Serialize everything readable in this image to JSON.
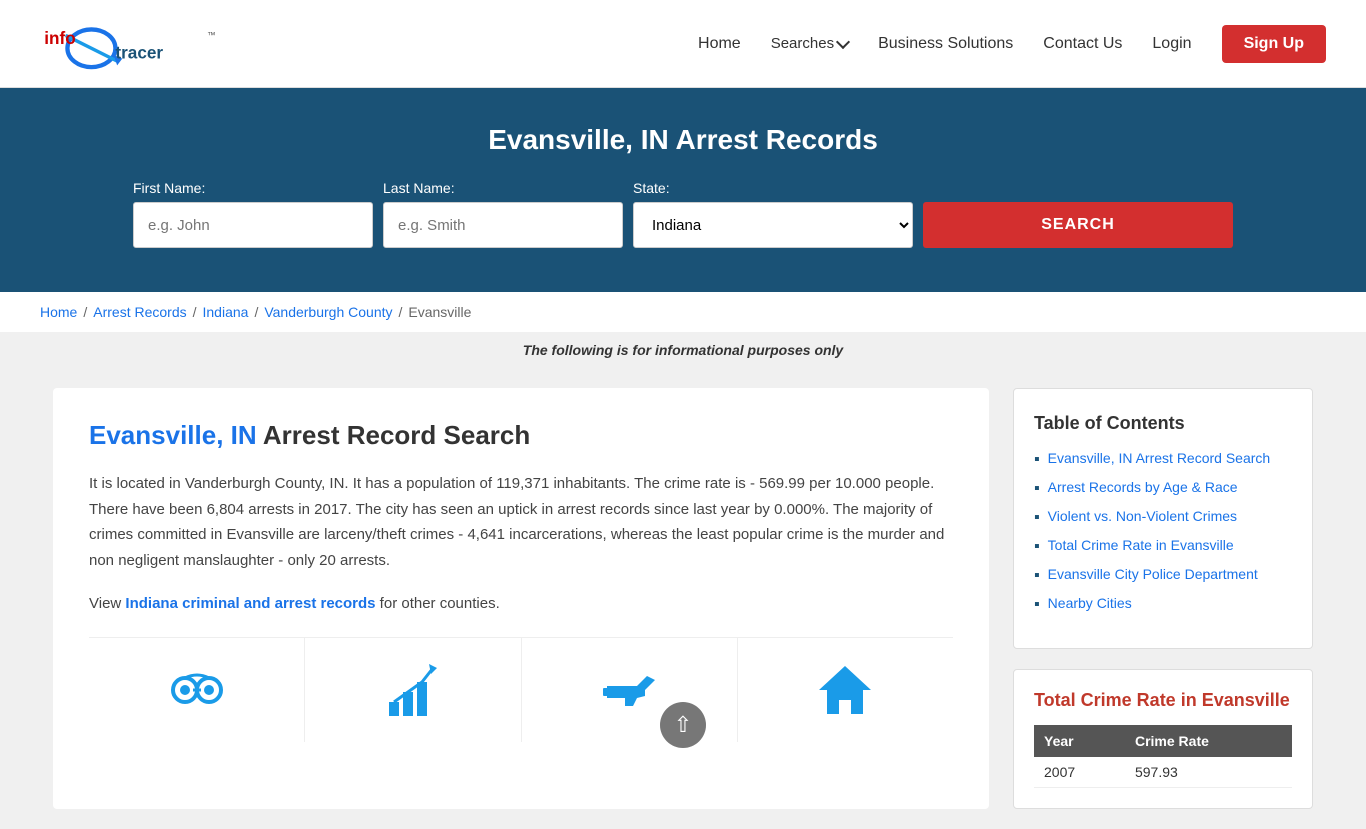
{
  "header": {
    "logo_alt": "InfoTracer",
    "nav": {
      "home": "Home",
      "searches": "Searches",
      "business_solutions": "Business Solutions",
      "contact_us": "Contact Us",
      "login": "Login",
      "signup": "Sign Up"
    }
  },
  "hero": {
    "title": "Evansville, IN Arrest Records",
    "form": {
      "first_name_label": "First Name:",
      "first_name_placeholder": "e.g. John",
      "last_name_label": "Last Name:",
      "last_name_placeholder": "e.g. Smith",
      "state_label": "State:",
      "state_value": "Indiana",
      "search_button": "SEARCH"
    }
  },
  "breadcrumb": {
    "home": "Home",
    "arrest_records": "Arrest Records",
    "indiana": "Indiana",
    "county": "Vanderburgh County",
    "city": "Evansville"
  },
  "disclaimer": "The following is for informational purposes only",
  "main": {
    "page_title_city": "Evansville,",
    "page_title_state": " IN ",
    "page_title_rest": "Arrest Record Search",
    "description": "It is located in Vanderburgh County, IN. It has a population of 119,371 inhabitants. The crime rate is - 569.99 per 10.000 people. There have been 6,804 arrests in 2017. The city has seen an uptick in arrest records since last year by 0.000%. The majority of crimes committed in Evansville are larceny/theft crimes - 4,641 incarcerations, whereas the least popular crime is the murder and non negligent manslaughter - only 20 arrests.",
    "view_prefix": "View ",
    "link_text": "Indiana criminal and arrest records",
    "view_suffix": " for other counties."
  },
  "toc": {
    "title": "Table of Contents",
    "items": [
      {
        "label": "Evansville, IN Arrest Record Search",
        "href": "#search"
      },
      {
        "label": "Arrest Records by Age & Race",
        "href": "#age-race"
      },
      {
        "label": "Violent vs. Non-Violent Crimes",
        "href": "#violent"
      },
      {
        "label": "Total Crime Rate in Evansville",
        "href": "#crime-rate"
      },
      {
        "label": "Evansville City Police Department",
        "href": "#police"
      },
      {
        "label": "Nearby Cities",
        "href": "#nearby"
      }
    ]
  },
  "crime_rate": {
    "title": "Total Crime Rate in Evansville",
    "table_headers": [
      "Year",
      "Crime Rate"
    ],
    "rows": [
      {
        "year": "2007",
        "rate": "597.93"
      }
    ]
  }
}
